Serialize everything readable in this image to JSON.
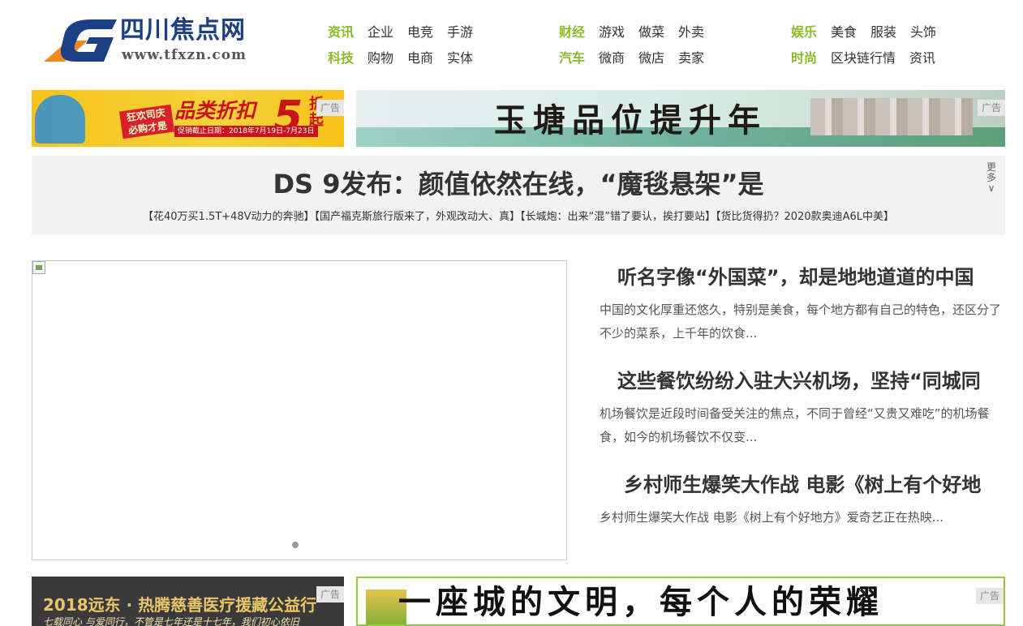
{
  "site": {
    "name": "四川焦点网",
    "url": "www.tfxzn.com"
  },
  "nav": {
    "groups": [
      {
        "row1": [
          "资讯",
          "企业",
          "电竞",
          "手游"
        ],
        "row2": [
          "科技",
          "购物",
          "电商",
          "实体"
        ]
      },
      {
        "row1": [
          "财经",
          "游戏",
          "做菜",
          "外卖"
        ],
        "row2": [
          "汽车",
          "微商",
          "微店",
          "卖家"
        ]
      },
      {
        "row1": [
          "娱乐",
          "美食",
          "服装",
          "头饰"
        ],
        "row2": [
          "时尚",
          "区块链行情",
          "资讯"
        ]
      }
    ]
  },
  "ad_label": "广告",
  "ads": {
    "top_left": {
      "headline": "品类折扣",
      "number": "5",
      "suffix": "折起",
      "badge": "狂欢司庆",
      "badge_sub": "必购才是",
      "promo_date": "促销截止日期：2018年7月19日-7月23日"
    },
    "top_right": {
      "text": "玉塘品位提升年"
    },
    "bottom_left": {
      "title": "2018远东 · 热腾慈善医疗援藏公益行",
      "subtitle": "七载同心 与爱同行，不管是七年还是十七年，我们初心依旧"
    },
    "bottom_right": {
      "text": "一座城的文明，每个人的荣耀"
    }
  },
  "headline": {
    "title": "DS 9发布：颜值依然在线，“魔毯悬架”是",
    "more": "更多",
    "links": [
      "【花40万买1.5T+48V动力的奔驰】",
      "【国产福克斯旅行版来了，外观改动大、真】",
      "【长城炮：出来“混”错了要认，挨打要站】",
      "【货比货得扔？2020款奥迪A6L中美】"
    ]
  },
  "articles": [
    {
      "title": "听名字像“外国菜”，却是地地道道的中国",
      "desc": "中国的文化厚重还悠久，特别是美食，每个地方都有自己的特色，还区分了不少的菜系，上千年的饮食..."
    },
    {
      "title": "这些餐饮纷纷入驻大兴机场，坚持“同城同",
      "desc": "机场餐饮是近段时间备受关注的焦点，不同于曾经“又贵又难吃”的机场餐食，如今的机场餐饮不仅变..."
    },
    {
      "title": "乡村师生爆笑大作战 电影《树上有个好地",
      "desc": "乡村师生爆笑大作战 电影《树上有个好地方》爱奇艺正在热映..."
    }
  ],
  "colors": {
    "nav_highlight": "#8bba2a",
    "logo_blue": "#1c3f86",
    "logo_orange": "#f08a1c",
    "headline_bg": "#f2f2f2"
  }
}
